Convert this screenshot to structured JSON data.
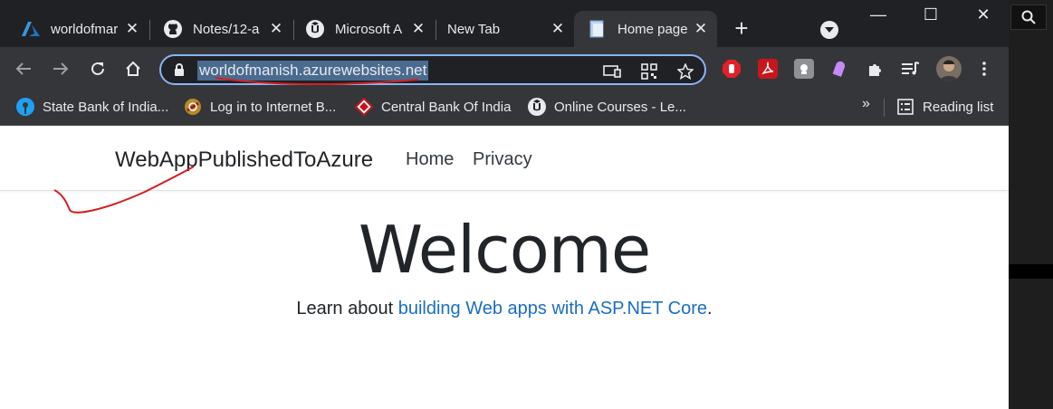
{
  "tabs": [
    {
      "title": "worldofmar",
      "icon": "azure-icon"
    },
    {
      "title": "Notes/12-a",
      "icon": "github-icon"
    },
    {
      "title": "Microsoft A",
      "icon": "udemy-icon"
    },
    {
      "title": "New Tab",
      "icon": ""
    },
    {
      "title": "Home page",
      "icon": "page-icon",
      "active": true
    }
  ],
  "toolbar": {
    "url": "worldofmanish.azurewebsites.net"
  },
  "bookmarks": [
    {
      "label": "State Bank of India...",
      "icon": "sbi-icon"
    },
    {
      "label": "Log in to Internet B...",
      "icon": "bank-icon"
    },
    {
      "label": "Central Bank Of India",
      "icon": "cbi-icon"
    },
    {
      "label": "Online Courses - Le...",
      "icon": "udemy-icon"
    }
  ],
  "bookmarks_more": "»",
  "reading_list": "Reading list",
  "site": {
    "brand": "WebAppPublishedToAzure",
    "nav": [
      "Home",
      "Privacy"
    ],
    "heading": "Welcome",
    "learn_prefix": "Learn about ",
    "learn_link": "building Web apps with ASP.NET Core",
    "learn_suffix": "."
  },
  "colors": {
    "tabstrip": "#202124",
    "toolbar": "#35363a",
    "omnibox_border": "#8ab4f8",
    "link": "#1b6ec2",
    "annotation": "#d31f1f"
  }
}
